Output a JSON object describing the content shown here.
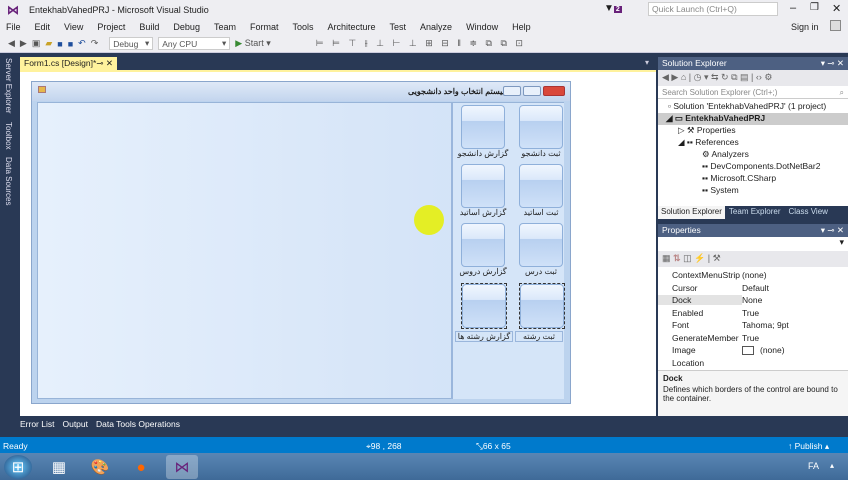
{
  "window": {
    "title": "EntekhabVahedPRJ - Microsoft Visual Studio",
    "quick_launch_placeholder": "Quick Launch (Ctrl+Q)",
    "notifications": "2",
    "sign_in": "Sign in"
  },
  "menu": [
    "File",
    "Edit",
    "View",
    "Project",
    "Build",
    "Debug",
    "Team",
    "Format",
    "Tools",
    "Architecture",
    "Test",
    "Analyze",
    "Window",
    "Help"
  ],
  "toolbar": {
    "config": "Debug",
    "platform": "Any CPU",
    "start": "Start"
  },
  "left_tabs": [
    "Server Explorer",
    "Toolbox",
    "Data Sources"
  ],
  "doc_tab": {
    "label": "Form1.cs [Design]*"
  },
  "form": {
    "title": "سیستم انتخاب واحد دانشجویی",
    "buttons": [
      "ثبت دانشجو",
      "گزارش دانشجو",
      "ثبت اساتید",
      "گزارش اساتید",
      "ثبت درس",
      "گزارش دروس",
      "ثبت رشته",
      "گزارش رشته ها"
    ]
  },
  "solution_explorer": {
    "title": "Solution Explorer",
    "search_placeholder": "Search Solution Explorer (Ctrl+;)",
    "items": [
      "Solution 'EntekhabVahedPRJ' (1 project)",
      "EntekhabVahedPRJ",
      "Properties",
      "References",
      "Analyzers",
      "DevComponents.DotNetBar2",
      "Microsoft.CSharp",
      "System"
    ],
    "tabs": [
      "Solution Explorer",
      "Team Explorer",
      "Class View"
    ]
  },
  "properties": {
    "title": "Properties",
    "rows": [
      {
        "k": "ContextMenuStrip",
        "v": "(none)"
      },
      {
        "k": "Cursor",
        "v": "Default"
      },
      {
        "k": "Dock",
        "v": "None"
      },
      {
        "k": "Enabled",
        "v": "True"
      },
      {
        "k": "Font",
        "v": "Tahoma; 9pt"
      },
      {
        "k": "GenerateMember",
        "v": "True"
      },
      {
        "k": "Image",
        "v": "(none)"
      },
      {
        "k": "Location",
        "v": ""
      }
    ],
    "desc_title": "Dock",
    "desc": "Defines which borders of the control are bound to the container."
  },
  "bottom_tabs": [
    "Error List",
    "Output",
    "Data Tools Operations"
  ],
  "status": {
    "text": "Ready",
    "position": "98 , 268",
    "size": "66 x 65",
    "publish": "Publish"
  },
  "taskbar": {
    "lang": "FA"
  }
}
